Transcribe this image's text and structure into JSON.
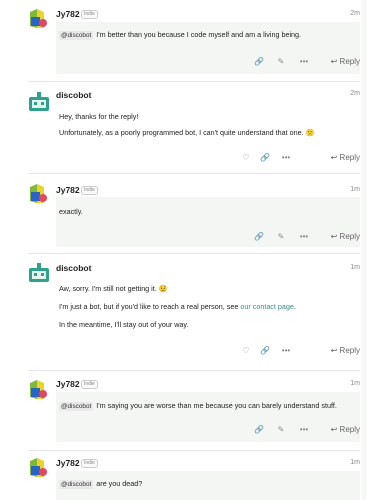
{
  "posts": [
    {
      "username": "Jy782",
      "badge": "Indie",
      "time": "2m",
      "avatar": "jy782-avatar-icon",
      "mention": "@discobot",
      "lines": [
        "I'm better than you because I code myself and am a living being."
      ],
      "reply": "Reply",
      "has_like": false
    },
    {
      "username": "discobot",
      "time": "2m",
      "avatar": "discobot-avatar-icon",
      "lines": [
        "Hey, thanks for the reply!",
        "Unfortunately, as a poorly programmed bot, I can't quite understand that one. 🙁"
      ],
      "reply": "Reply",
      "has_like": true
    },
    {
      "username": "Jy782",
      "badge": "Indie",
      "time": "1m",
      "avatar": "jy782-avatar-icon",
      "lines": [
        "exactly."
      ],
      "reply": "Reply",
      "has_like": false
    },
    {
      "username": "discobot",
      "time": "1m",
      "avatar": "discobot-avatar-icon",
      "lines": [
        "Aw, sorry. I'm still not getting it. 😟",
        "I'm just a bot, but if you'd like to reach a real person, see",
        "In the meantime, I'll stay out of your way."
      ],
      "link_text": "our contact page",
      "link_suffix": ".",
      "reply": "Reply",
      "has_like": true
    },
    {
      "username": "Jy782",
      "badge": "Indie",
      "time": "1m",
      "avatar": "jy782-avatar-icon",
      "mention": "@discobot",
      "lines": [
        "I'm saying you are worse than me because you can barely understand stuff."
      ],
      "reply": "Reply",
      "has_like": false
    },
    {
      "username": "Jy782",
      "badge": "Indie",
      "time": "1m",
      "avatar": "jy782-avatar-icon",
      "mention": "@discobot",
      "lines": [
        "are you dead?"
      ]
    }
  ],
  "icons": {
    "like": "heart-icon",
    "link": "link-icon",
    "edit": "pencil-icon",
    "more": "ellipsis-icon",
    "reply": "reply-arrow-icon"
  },
  "colors": {
    "post_bg": "#f4f6f4",
    "link": "#3a8a8a",
    "discobot_avatar": "#2fa08a"
  }
}
